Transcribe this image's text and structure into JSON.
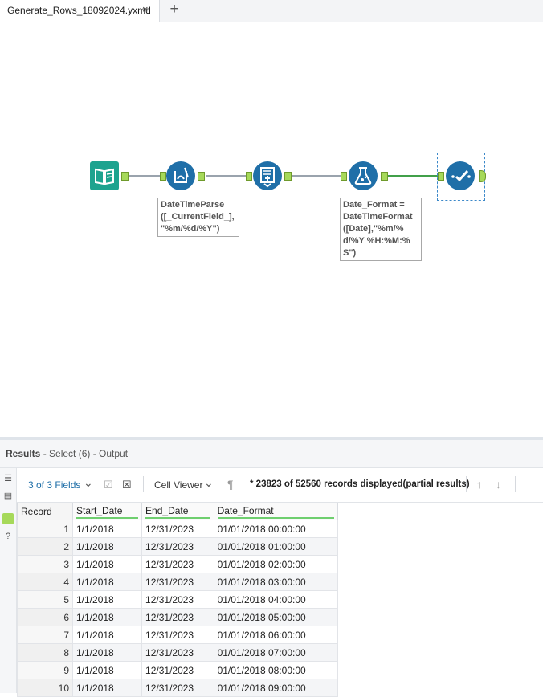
{
  "tab": {
    "title": "Generate_Rows_18092024.yxmd",
    "close": "×",
    "add": "+"
  },
  "annotations": {
    "parse": [
      "DateTimeParse",
      "([_CurrentField_],",
      "\"%m/%d/%Y\")"
    ],
    "format": [
      "Date_Format =",
      "DateTimeFormat",
      "([Date],\"%m/%",
      "d/%Y %H:%M:%",
      "S\")"
    ]
  },
  "results": {
    "title": "Results",
    "subtitle": " - Select (6) - Output"
  },
  "toolbar": {
    "fields": "3 of 3 Fields",
    "fields_caret": "⌄",
    "viewer": "Cell Viewer",
    "viewer_caret": "⌄",
    "pilcrow": "¶",
    "records": "* 23823 of 52560 records displayed(partial results)",
    "up": "↑",
    "down": "↓"
  },
  "grid": {
    "headers": [
      "Record",
      "Start_Date",
      "End_Date",
      "Date_Format"
    ],
    "rows": [
      [
        "1",
        "1/1/2018",
        "12/31/2023",
        "01/01/2018 00:00:00"
      ],
      [
        "2",
        "1/1/2018",
        "12/31/2023",
        "01/01/2018 01:00:00"
      ],
      [
        "3",
        "1/1/2018",
        "12/31/2023",
        "01/01/2018 02:00:00"
      ],
      [
        "4",
        "1/1/2018",
        "12/31/2023",
        "01/01/2018 03:00:00"
      ],
      [
        "5",
        "1/1/2018",
        "12/31/2023",
        "01/01/2018 04:00:00"
      ],
      [
        "6",
        "1/1/2018",
        "12/31/2023",
        "01/01/2018 05:00:00"
      ],
      [
        "7",
        "1/1/2018",
        "12/31/2023",
        "01/01/2018 06:00:00"
      ],
      [
        "8",
        "1/1/2018",
        "12/31/2023",
        "01/01/2018 07:00:00"
      ],
      [
        "9",
        "1/1/2018",
        "12/31/2023",
        "01/01/2018 08:00:00"
      ],
      [
        "10",
        "1/1/2018",
        "12/31/2023",
        "01/01/2018 09:00:00"
      ]
    ]
  },
  "colors": {
    "tool_blue": "#1f6fa8",
    "input_teal": "#1da38f",
    "anchor_green": "#a6d95a",
    "link_blue": "#1f6fa8"
  },
  "icons": [
    "input-data-icon",
    "datetime-icon",
    "generate-rows-icon",
    "formula-icon",
    "select-icon"
  ]
}
